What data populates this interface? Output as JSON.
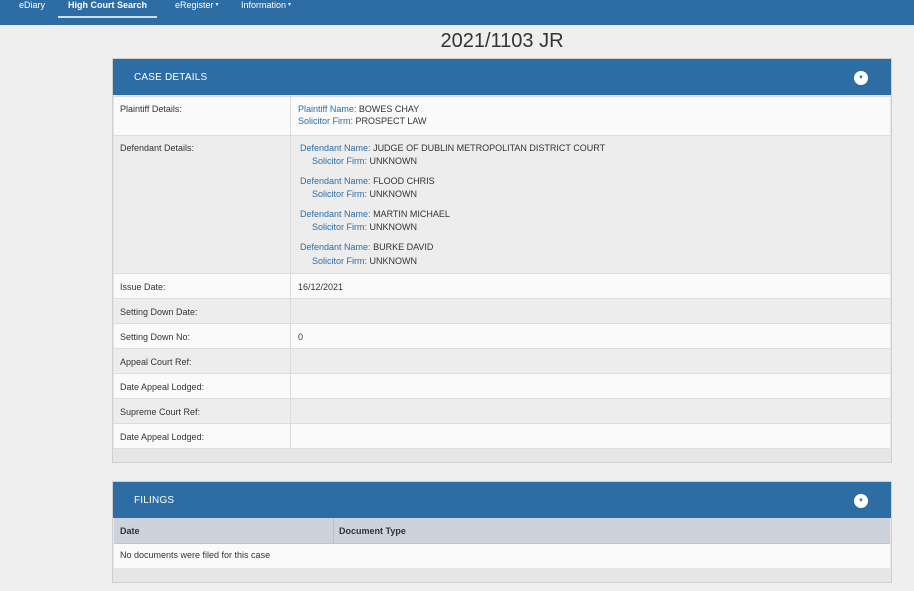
{
  "nav": {
    "items": [
      {
        "label": "eDiary",
        "dropdown": false
      },
      {
        "label": "High Court Search",
        "dropdown": false,
        "active": true
      },
      {
        "label": "eRegister",
        "dropdown": true
      },
      {
        "label": "Information",
        "dropdown": true
      }
    ]
  },
  "case": {
    "title": "2021/1103 JR"
  },
  "case_details": {
    "heading": "CASE DETAILS",
    "plaintiff": {
      "label": "Plaintiff Details:",
      "name_key": "Plaintiff Name:",
      "name": "BOWES CHAY",
      "firm_key": "Solicitor Firm:",
      "firm": "PROSPECT LAW"
    },
    "defendants": {
      "label": "Defendant Details:",
      "name_key": "Defendant Name:",
      "firm_key": "Solicitor Firm:",
      "items": [
        {
          "name": "JUDGE OF DUBLIN METROPOLITAN DISTRICT COURT",
          "firm": "UNKNOWN"
        },
        {
          "name": "FLOOD CHRIS",
          "firm": "UNKNOWN"
        },
        {
          "name": "MARTIN MICHAEL",
          "firm": "UNKNOWN"
        },
        {
          "name": "BURKE DAVID",
          "firm": "UNKNOWN"
        }
      ]
    },
    "fields": [
      {
        "label": "Issue Date:",
        "value": "16/12/2021"
      },
      {
        "label": "Setting Down Date:",
        "value": ""
      },
      {
        "label": "Setting Down No:",
        "value": "0"
      },
      {
        "label": "Appeal Court Ref:",
        "value": ""
      },
      {
        "label": "Date Appeal Lodged:",
        "value": ""
      },
      {
        "label": "Supreme Court Ref:",
        "value": ""
      },
      {
        "label": "Date Appeal Lodged:",
        "value": ""
      }
    ]
  },
  "filings": {
    "heading": "FILINGS",
    "columns": [
      "Date",
      "Document Type"
    ],
    "empty_message": "No documents were filed for this case"
  },
  "icons": {
    "collapse": "chevron-down-icon",
    "caret": "caret-down-icon"
  },
  "colors": {
    "brand": "#2e6da4",
    "table_header": "#ccd3dd"
  }
}
